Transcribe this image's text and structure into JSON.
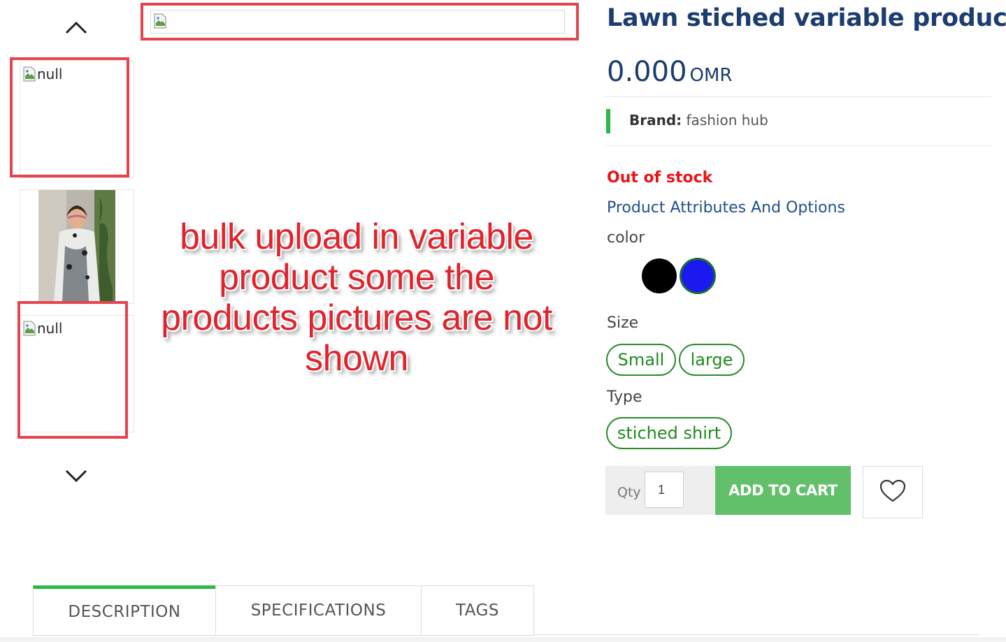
{
  "gallery": {
    "thumbnails": [
      {
        "type": "broken",
        "alt": "null"
      },
      {
        "type": "photo"
      },
      {
        "type": "broken",
        "alt": "null"
      }
    ]
  },
  "annotation": {
    "text": "bulk upload in variable product some the products pictures are not shown",
    "color": "#e0232d"
  },
  "product": {
    "title": "Lawn stiched variable products",
    "price": "0.000",
    "currency": "OMR",
    "brand_label": "Brand:",
    "brand_value": "fashion hub",
    "stock_status": "Out of stock",
    "attributes_title": "Product Attributes And Options",
    "color_label": "color",
    "colors": [
      {
        "name": "black",
        "hex": "#000000"
      },
      {
        "name": "blue",
        "hex": "#1a1af0"
      }
    ],
    "size_label": "Size",
    "sizes": [
      "Small",
      "large"
    ],
    "type_label": "Type",
    "types": [
      "stiched shirt"
    ]
  },
  "cart": {
    "qty_label": "Qty",
    "qty_value": "1",
    "add_to_cart": "ADD TO CART",
    "wishlist_icon": "heart-icon"
  },
  "tabs": [
    "DESCRIPTION",
    "SPECIFICATIONS",
    "TAGS"
  ],
  "colors": {
    "title": "#1c3d6e",
    "accent_green": "#2db84a",
    "button_green": "#62c06a",
    "out_of_stock": "#e8141c",
    "highlight_box": "#e4444f"
  }
}
